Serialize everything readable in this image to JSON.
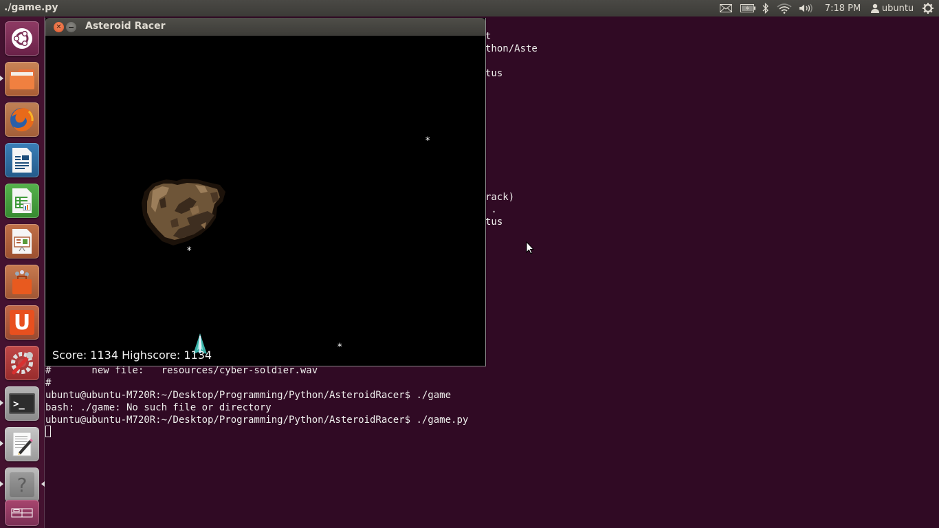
{
  "top_panel": {
    "app_title": "./game.py",
    "clock": "7:18 PM",
    "user": "ubuntu",
    "indicators": [
      "mail-icon",
      "battery-icon",
      "bluetooth-icon",
      "wifi-icon",
      "volume-icon",
      "user-icon",
      "power-gear-icon"
    ]
  },
  "launcher": {
    "items": [
      {
        "name": "dash-home",
        "icon": "ubuntu-logo-icon",
        "color": "#7a2f55"
      },
      {
        "name": "files",
        "icon": "folder-icon",
        "color": "#c06a3a",
        "running": true
      },
      {
        "name": "firefox",
        "icon": "firefox-icon",
        "color": "#b5683e",
        "running": true
      },
      {
        "name": "libreoffice-writer",
        "icon": "writer-icon",
        "color": "#2f6fa8"
      },
      {
        "name": "libreoffice-calc",
        "icon": "calc-icon",
        "color": "#3f9a3a"
      },
      {
        "name": "libreoffice-impress",
        "icon": "impress-icon",
        "color": "#b0603a"
      },
      {
        "name": "software-center",
        "icon": "shopping-bag-icon",
        "color": "#c0643a"
      },
      {
        "name": "ubuntu-one",
        "icon": "ubuntu-one-icon",
        "color": "#b85a3a"
      },
      {
        "name": "system-settings",
        "icon": "settings-wrench-icon",
        "color": "#b83a3a"
      },
      {
        "name": "terminal",
        "icon": "terminal-icon",
        "color": "#8a8a8a",
        "running": true
      },
      {
        "name": "text-editor",
        "icon": "text-editor-icon",
        "color": "#a0a0a0",
        "running": true
      },
      {
        "name": "unknown-app",
        "icon": "question-mark-icon",
        "color": "#8a8a8a",
        "running": true,
        "focused": true
      },
      {
        "name": "workspace-switcher",
        "icon": "workspace-icon",
        "color": "#7a2f55"
      }
    ]
  },
  "terminal": {
    "partial_lines": [
      {
        "text": "t"
      },
      {
        "text": "thon/Aste"
      },
      {
        "text": "tus"
      },
      {
        "text": "rack)"
      },
      {
        "text": " ."
      },
      {
        "text": "tus"
      }
    ],
    "lines": [
      "#       new file:   resources/cyber-soldier.wav",
      "#",
      "ubuntu@ubuntu-M720R:~/Desktop/Programming/Python/AsteroidRacer$ ./game",
      "bash: ./game: No such file or directory",
      "ubuntu@ubuntu-M720R:~/Desktop/Programming/Python/AsteroidRacer$ ./game.py"
    ],
    "background": "#300a24"
  },
  "game_window": {
    "title": "Asteroid Racer",
    "score_label": "Score:",
    "score": "1134",
    "highscore_label": "Highscore:",
    "highscore": "1134",
    "star_glyph": "*"
  }
}
